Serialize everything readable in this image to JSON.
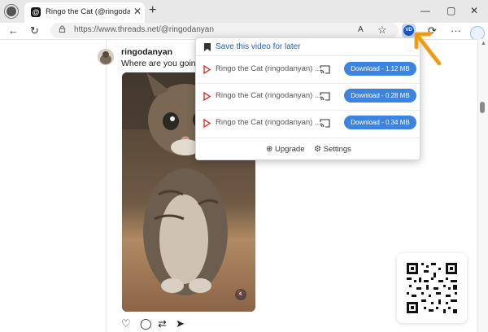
{
  "tab": {
    "title": "Ringo the Cat (@ringodanyan) o",
    "close": "✕",
    "favicon": "@"
  },
  "newtab": "+",
  "window": {
    "minimize": "—",
    "maximize": "▢",
    "close": "✕"
  },
  "toolbar": {
    "back": "←",
    "reload": "↻",
    "read_aloud": "A",
    "favorite": "☆",
    "extensions": "⟳",
    "menu": "···"
  },
  "urlbar": {
    "url": "https://www.threads.net/@ringodanyan"
  },
  "extension": {
    "logo": "VD"
  },
  "post": {
    "username": "ringodanyan",
    "text": "Where are you going?",
    "mute": "🔇",
    "actions": [
      "♡",
      "◯",
      "⇄",
      "➤"
    ]
  },
  "popup": {
    "save_label": "Save this video for later",
    "rows": [
      {
        "title": "Ringo the Cat (ringodanyan) ...",
        "button": "Download - 1.12 MB"
      },
      {
        "title": "Ringo the Cat (ringodanyan) ...",
        "button": "Download - 0.28 MB"
      },
      {
        "title": "Ringo the Cat (ringodanyan) ...",
        "button": "Download - 0.34 MB"
      }
    ],
    "upgrade": "Upgrade",
    "settings": "Settings",
    "upgrade_icon": "⊕",
    "settings_icon": "⚙"
  },
  "colors": {
    "accent": "#3d84e0",
    "link": "#1f5fb8",
    "play": "#d0382e",
    "arrow": "#f0a21a"
  }
}
